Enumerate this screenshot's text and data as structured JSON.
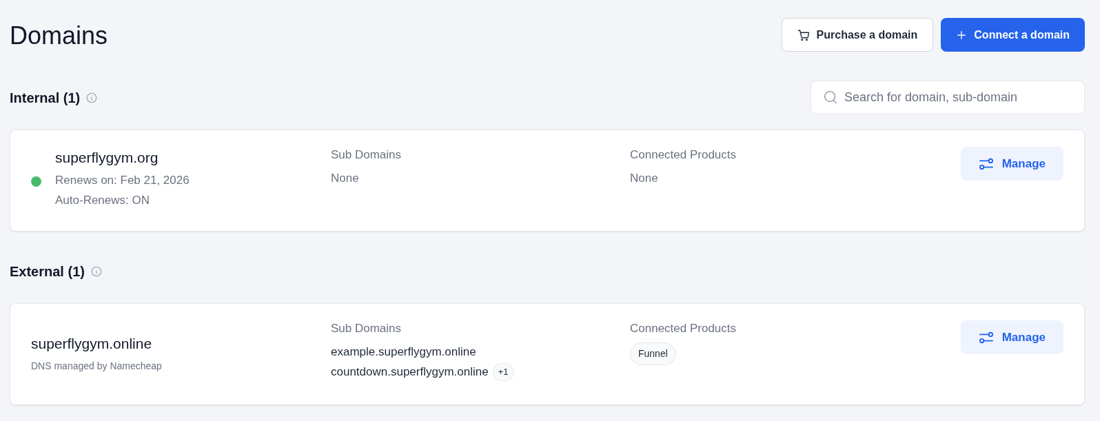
{
  "page": {
    "title": "Domains"
  },
  "actions": [
    {
      "label": "Purchase a domain",
      "kind": "secondary"
    },
    {
      "label": "Connect a domain",
      "kind": "primary"
    }
  ],
  "search": {
    "placeholder": "Search for domain, sub-domain"
  },
  "sections": [
    {
      "title": "Internal (1)",
      "domains": [
        {
          "name": "superflygym.org",
          "color": "#48bb6b",
          "details": [
            {
              "text": "Renews on: Feb 21, 2026",
              "kind": "line"
            },
            {
              "text": "Auto-Renews: ON",
              "kind": "line"
            }
          ],
          "sub_domains": {
            "label": "Sub Domains",
            "items": [
              "None"
            ]
          },
          "products": {
            "label": "Connected Products",
            "empty": "None"
          },
          "manage": "Manage"
        }
      ]
    },
    {
      "title": "External (1)",
      "domains": [
        {
          "name": "superflygym.online",
          "details": [
            {
              "text": "DNS managed by Namecheap",
              "kind": "note"
            }
          ],
          "sub_domains": {
            "label": "Sub Domains",
            "items": [
              "example.superflygym.online",
              "countdown.superflygym.online"
            ],
            "more": "+1"
          },
          "products": {
            "label": "Connected Products",
            "tags": [
              "Funnel"
            ]
          },
          "manage": "Manage"
        }
      ]
    }
  ]
}
